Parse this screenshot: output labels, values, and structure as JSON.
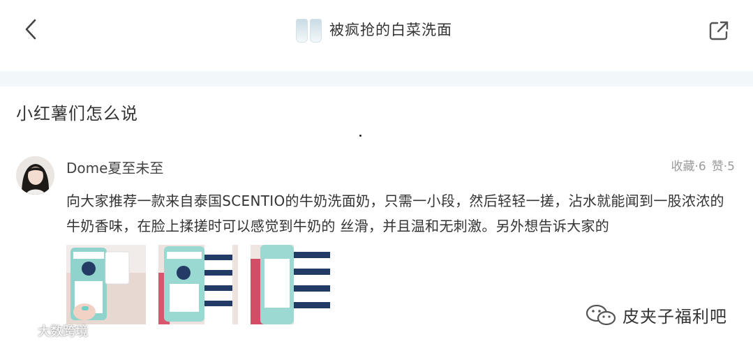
{
  "nav": {
    "title": "被疯抢的白菜洗面",
    "back_icon": "chevron-left-icon",
    "share_icon": "share-external-icon"
  },
  "section": {
    "title": "小红薯们怎么说"
  },
  "post": {
    "author": "Dome夏至未至",
    "favorites": "收藏·6",
    "likes": "赞·5",
    "text": "向大家推荐一款来自泰国SCENTIO的牛奶洗面奶，只需一小段，然后轻轻一搓，沾水就能闻到一股浓浓的牛奶香味，在脸上揉搓时可以感觉到牛奶的 丝滑，并且温和无刺激。另外想告诉大家的"
  },
  "watermarks": {
    "left": "大数跨境",
    "right": "皮夹子福利吧"
  },
  "colors": {
    "background": "#ffffff",
    "divider": "#f2f7fa",
    "meta_text": "#9a9a9a",
    "body_text": "#333333"
  }
}
